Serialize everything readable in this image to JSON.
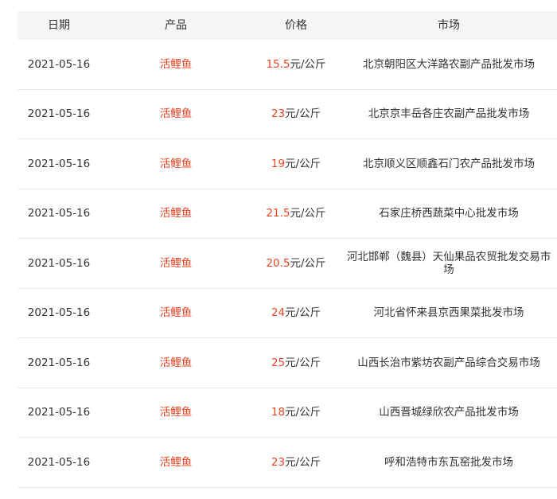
{
  "colors": {
    "accent": "#ee4422",
    "header_bg": "#f5f5f5",
    "divider": "#e8e8e8",
    "text": "#333333"
  },
  "table": {
    "headers": {
      "date": "日期",
      "product": "产品",
      "price": "价格",
      "market": "市场"
    },
    "rows": [
      {
        "date": "2021-05-16",
        "product": "活鲤鱼",
        "price": "15.5",
        "unit": "元/公斤",
        "market": "北京朝阳区大洋路农副产品批发市场"
      },
      {
        "date": "2021-05-16",
        "product": "活鲤鱼",
        "price": "23",
        "unit": "元/公斤",
        "market": "北京京丰岳各庄农副产品批发市场"
      },
      {
        "date": "2021-05-16",
        "product": "活鲤鱼",
        "price": "19",
        "unit": "元/公斤",
        "market": "北京顺义区顺鑫石门农产品批发市场"
      },
      {
        "date": "2021-05-16",
        "product": "活鲤鱼",
        "price": "21.5",
        "unit": "元/公斤",
        "market": "石家庄桥西蔬菜中心批发市场"
      },
      {
        "date": "2021-05-16",
        "product": "活鲤鱼",
        "price": "20.5",
        "unit": "元/公斤",
        "market": "河北邯郸（魏县）天仙果品农贸批发交易市场"
      },
      {
        "date": "2021-05-16",
        "product": "活鲤鱼",
        "price": "24",
        "unit": "元/公斤",
        "market": "河北省怀来县京西果菜批发市场"
      },
      {
        "date": "2021-05-16",
        "product": "活鲤鱼",
        "price": "25",
        "unit": "元/公斤",
        "market": "山西长治市紫坊农副产品综合交易市场"
      },
      {
        "date": "2021-05-16",
        "product": "活鲤鱼",
        "price": "18",
        "unit": "元/公斤",
        "market": "山西晋城绿欣农产品批发市场"
      },
      {
        "date": "2021-05-16",
        "product": "活鲤鱼",
        "price": "23",
        "unit": "元/公斤",
        "market": "呼和浩特市东瓦窑批发市场"
      }
    ]
  }
}
